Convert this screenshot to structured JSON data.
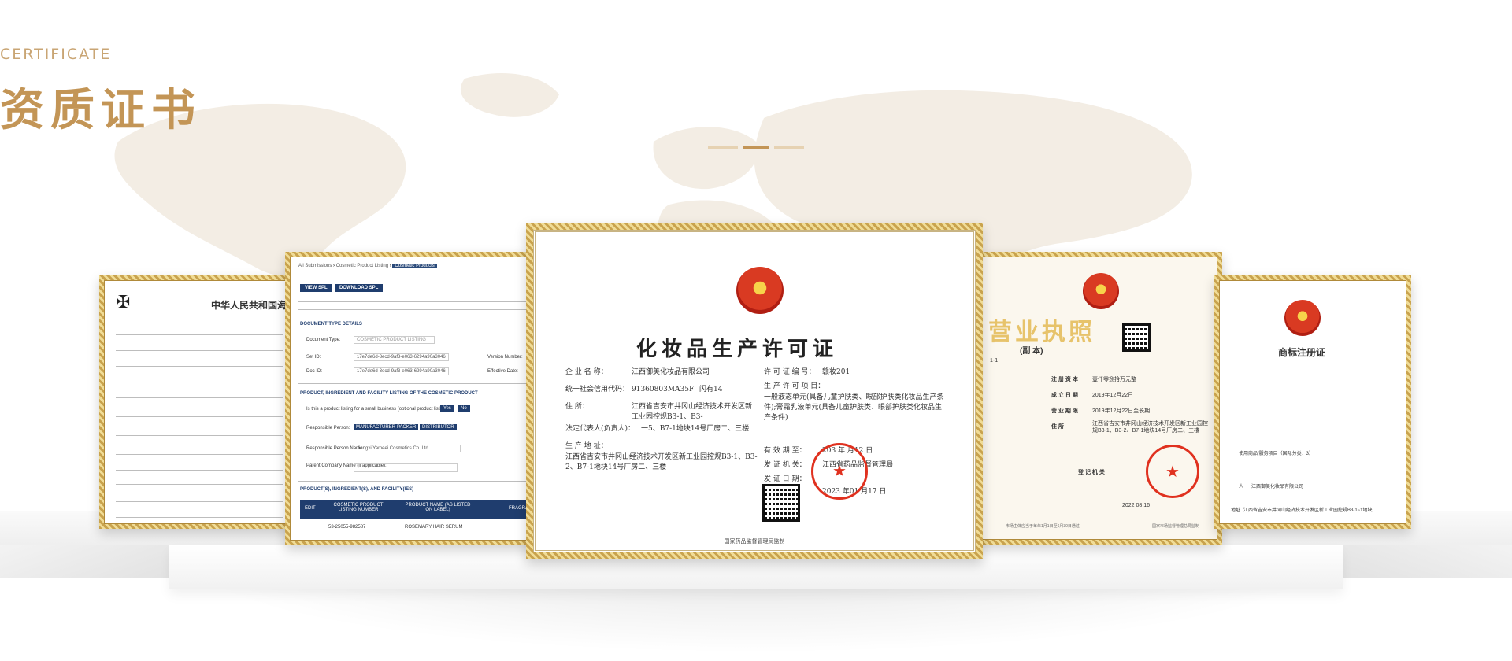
{
  "header": {
    "subtitle": "CERTIFICATE",
    "title": "资质证书"
  },
  "colors": {
    "accent": "#c39556",
    "frame_gold": "#c9a34e",
    "seal_red": "#e0311f"
  },
  "certificates": {
    "customs": {
      "title": "中华人民共和国海关进"
    },
    "fda": {
      "breadcrumb": [
        "All Submissions",
        "Cosmetic Product Listing",
        "Cosmetic Products"
      ],
      "buttons": [
        "VIEW SPL",
        "DOWNLOAD SPL"
      ],
      "sections": [
        "DOCUMENT TYPE DETAILS",
        "PRODUCT, INGREDIENT AND FACILITY LISTING OF THE COSMETIC PRODUCT",
        "PRODUCT(S), INGREDIENT(S), AND FACILITY(IES)"
      ],
      "doc_type_label": "Document Type:",
      "doc_type_value": "COSMETIC PRODUCT LISTING",
      "set_id_label": "Set ID:",
      "set_id_value": "17e7de6d-3ecd-9af3-e063-6294a90a3046",
      "doc_id_label": "Doc ID:",
      "doc_id_value": "17e7de6d-3ecd-9af3-e063-6294a90a3046",
      "version_label": "Version Number:",
      "effective_label": "Effective Date:",
      "small_business_q": "Is this a product listing for a small business (optional product listing)?",
      "yes": "Yes",
      "no": "No",
      "rp_label": "Responsible Person:",
      "roles": [
        "MANUFACTURER",
        "PACKER",
        "DISTRIBUTOR"
      ],
      "rp_name_label": "Responsible Person Name:",
      "rp_name_value": "Jiangxi Yameei Cosmetics Co.,Ltd",
      "parent_label": "Parent Company Name (if applicable):",
      "table_headers": [
        "EDIT",
        "COSMETIC PRODUCT LISTING NUMBER",
        "PRODUCT NAME (AS LISTED ON LABEL)",
        "FRAGRA"
      ],
      "row": [
        "53-25055-982587",
        "ROSEMARY HAIR SERUM"
      ]
    },
    "license": {
      "title": "化妆品生产许可证",
      "company_label": "企 业 名 称：",
      "company_value": "江西御美化妆品有限公司",
      "credit_label": "统一社会信用代码：",
      "credit_value": "91360803MA35F",
      "credit_suffix": "闪有14",
      "address_label": "住 所：",
      "address_value": "江西省吉安市井冈山经济技术开发区新工业园控规B3-1、B3-",
      "legal_label": "法定代表人(负责人)：",
      "legal_suffix": "一5、B7-1地块14号厂房二、三楼",
      "prod_addr_label": "生 产 地 址：",
      "prod_addr_value": "江西省吉安市井冈山经济技术开发区新工业园控规B3-1、B3-2、B7-1地块14号厂房二、三楼",
      "permit_no_label": "许 可 证 编 号：",
      "permit_no_value": "赣妆201",
      "items_label": "生 产 许 可 项 目：",
      "items_value": "一般液态单元(具备儿童护肤类、眼部护肤类化妆品生产条件);膏霜乳液单元(具备儿童护肤类、眼部护肤类化妆品生产条件)",
      "valid_label": "有 效 期 至：",
      "valid_value": "203 年 月12 日",
      "issuer_label": "发 证 机 关：",
      "issuer_value": "江西省药品监督管理局",
      "issuer_date_label": "发 证 日 期：",
      "issuer_date_value": "2023 年01 月17 日",
      "footer": "国家药品监督管理局监制"
    },
    "business": {
      "title": "营业执照",
      "copy": "(副 本)",
      "copy_no": "1-1",
      "rows": [
        [
          "注 册 资 本",
          "壹仟零捌拾万元整"
        ],
        [
          "成 立 日 期",
          "2019年12月22日"
        ],
        [
          "营 业 期 限",
          "2019年12月22日至长期"
        ],
        [
          "住 所",
          "江西省吉安市井冈山经济技术开发区新工业园控规B3-1、B3-2、B7-1地块14号厂房二、三楼"
        ]
      ],
      "authority_label": "登 记 机 关",
      "date": "2022  08  16",
      "footer_left": "市场主体应当于每年1月1日至6月30日通过",
      "footer_right": "国家市场监督管理总局监制"
    },
    "trademark": {
      "title": "商标注册证",
      "goods_label": "使用商品/服务项目（国际分类：3）",
      "registrant_label": "人",
      "registrant_value": "江西御美化妆品有限公司",
      "address_label": "地址",
      "address_value": "江西省吉安市井冈山经济技术开发区新工业园控规B3-1~1地块"
    }
  }
}
